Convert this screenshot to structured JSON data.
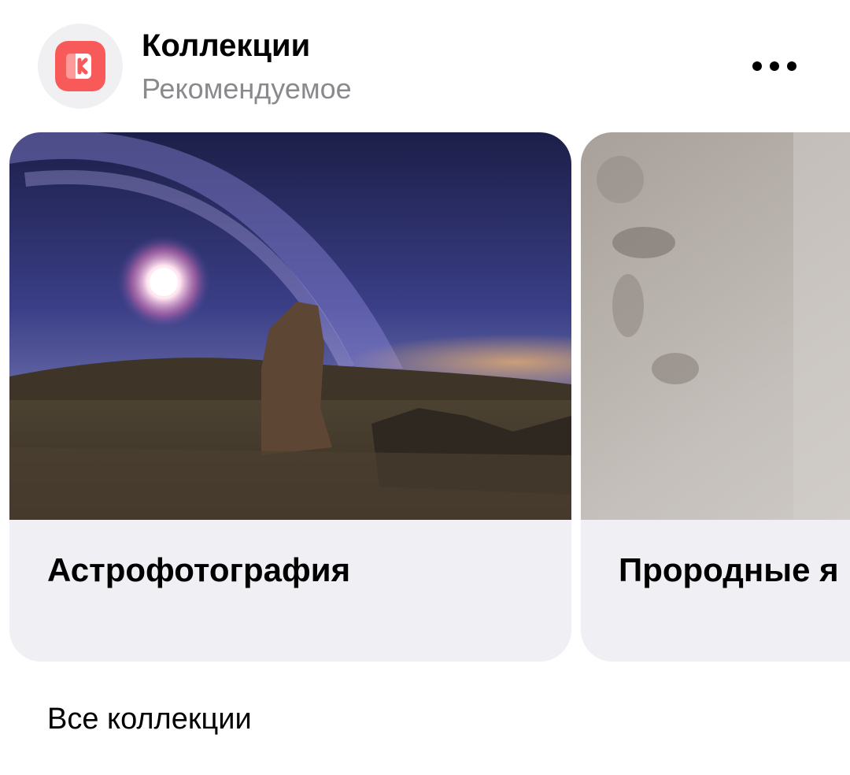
{
  "header": {
    "title": "Коллекции",
    "subtitle": "Рекомендуемое",
    "logo_icon": "collections-logo-icon",
    "more_icon": "more-horizontal-icon"
  },
  "colors": {
    "logo_red": "#f85a5a",
    "subtitle_gray": "#8a8a8e",
    "card_background": "#f0f0f4"
  },
  "cards": [
    {
      "label": "Астрофотография",
      "image": "night-sky-photo"
    },
    {
      "label": "Прородные я",
      "image": "gray-texture-photo"
    }
  ],
  "footer": {
    "all_collections": "Все коллекции"
  }
}
